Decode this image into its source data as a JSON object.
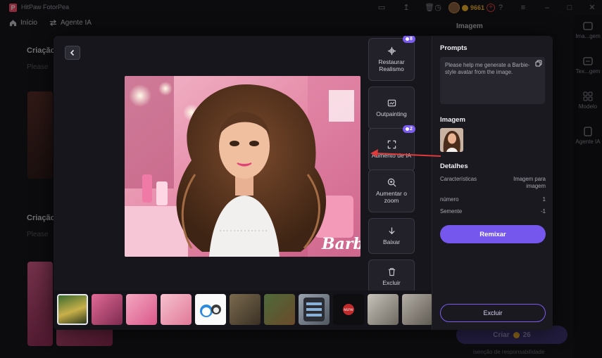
{
  "app": {
    "title": "HitPaw FotorPea",
    "credits": "9661",
    "colors": {
      "accent": "#7557ee",
      "coin": "#f2b12a",
      "danger": "#e14040"
    }
  },
  "topnav": {
    "home": "Início",
    "agent": "Agente IA"
  },
  "background": {
    "panel_title": "Imagem",
    "section1_title": "Criação",
    "section1_sub": "Please",
    "section2_title": "Criação",
    "section2_sub": "Please",
    "create_label": "Criar",
    "create_cost": "26",
    "disclaimer": "isenção de responsabilidade",
    "rail": [
      {
        "label": "Ima...gem",
        "icon": "image-icon"
      },
      {
        "label": "Tex...gem",
        "icon": "text-icon"
      },
      {
        "label": "Modelo",
        "icon": "grid-icon"
      },
      {
        "label": "Agente IA",
        "icon": "agent-icon"
      }
    ]
  },
  "tools": [
    {
      "id": "restore",
      "label": "Restaurar\nRealismo",
      "icon": "restore-icon",
      "badge": "8"
    },
    {
      "id": "outpaint",
      "label": "Outpainting",
      "icon": "outpaint-icon",
      "badge": ""
    },
    {
      "id": "upscale",
      "label": "Aumento de IA",
      "icon": "expand-icon",
      "badge": "2"
    },
    {
      "id": "zoom",
      "label": "Aumentar o\nzoom",
      "icon": "zoom-icon",
      "badge": ""
    },
    {
      "id": "download",
      "label": "Baixar",
      "icon": "download-icon",
      "badge": ""
    },
    {
      "id": "delete",
      "label": "Excluir",
      "icon": "trash-icon",
      "badge": ""
    }
  ],
  "panel": {
    "prompts_title": "Prompts",
    "prompt_text": "Please help me generate a Barbie-style avatar from the image.",
    "image_title": "Imagem",
    "details_title": "Detalhes",
    "details": [
      {
        "key": "Características",
        "value": "Imagem para imagem"
      },
      {
        "key": "número",
        "value": "1"
      },
      {
        "key": "Semente",
        "value": "-1"
      }
    ],
    "remix_label": "Remixar",
    "delete_label": "Excluir"
  },
  "main_image": {
    "watermark": "Barbie"
  },
  "filmstrip": [
    {
      "theme": "green-doll",
      "selected": true,
      "caption": ""
    },
    {
      "theme": "pink-box",
      "selected": false,
      "caption": ""
    },
    {
      "theme": "pink-box",
      "selected": false,
      "caption": ""
    },
    {
      "theme": "pink-room",
      "selected": false,
      "caption": ""
    },
    {
      "theme": "doraemon",
      "selected": false,
      "caption": ""
    },
    {
      "theme": "living-room",
      "selected": false,
      "caption": ""
    },
    {
      "theme": "kids-room",
      "selected": false,
      "caption": ""
    },
    {
      "theme": "phone-ui",
      "selected": false,
      "caption": ""
    },
    {
      "theme": "dark-logo",
      "selected": false,
      "caption": "NSFW"
    },
    {
      "theme": "phone-hand",
      "selected": false,
      "caption": ""
    },
    {
      "theme": "phone-hand",
      "selected": false,
      "caption": ""
    }
  ]
}
